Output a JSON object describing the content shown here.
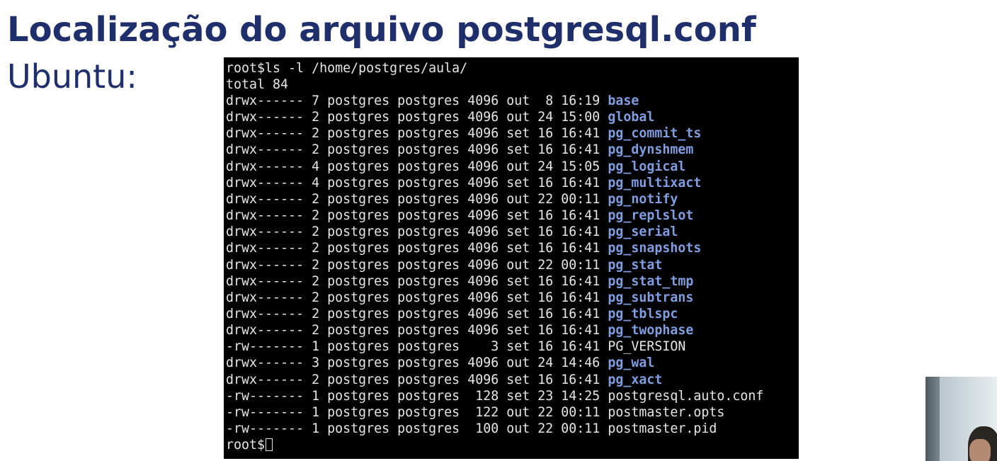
{
  "slide": {
    "title": "Localização do arquivo postgresql.conf",
    "subtitle": "Ubuntu:"
  },
  "terminal": {
    "top_fragment": "",
    "command_line": "root$ls -l /home/postgres/aula/",
    "total_line": "total 84",
    "entries": [
      {
        "info": "drwx------ 7 postgres postgres 4096 out  8 16:19 ",
        "name": "base",
        "type": "dir"
      },
      {
        "info": "drwx------ 2 postgres postgres 4096 out 24 15:00 ",
        "name": "global",
        "type": "dir"
      },
      {
        "info": "drwx------ 2 postgres postgres 4096 set 16 16:41 ",
        "name": "pg_commit_ts",
        "type": "dir"
      },
      {
        "info": "drwx------ 2 postgres postgres 4096 set 16 16:41 ",
        "name": "pg_dynshmem",
        "type": "dir"
      },
      {
        "info": "drwx------ 4 postgres postgres 4096 out 24 15:05 ",
        "name": "pg_logical",
        "type": "dir"
      },
      {
        "info": "drwx------ 4 postgres postgres 4096 set 16 16:41 ",
        "name": "pg_multixact",
        "type": "dir"
      },
      {
        "info": "drwx------ 2 postgres postgres 4096 out 22 00:11 ",
        "name": "pg_notify",
        "type": "dir"
      },
      {
        "info": "drwx------ 2 postgres postgres 4096 set 16 16:41 ",
        "name": "pg_replslot",
        "type": "dir"
      },
      {
        "info": "drwx------ 2 postgres postgres 4096 set 16 16:41 ",
        "name": "pg_serial",
        "type": "dir"
      },
      {
        "info": "drwx------ 2 postgres postgres 4096 set 16 16:41 ",
        "name": "pg_snapshots",
        "type": "dir"
      },
      {
        "info": "drwx------ 2 postgres postgres 4096 out 22 00:11 ",
        "name": "pg_stat",
        "type": "dir"
      },
      {
        "info": "drwx------ 2 postgres postgres 4096 set 16 16:41 ",
        "name": "pg_stat_tmp",
        "type": "dir"
      },
      {
        "info": "drwx------ 2 postgres postgres 4096 set 16 16:41 ",
        "name": "pg_subtrans",
        "type": "dir"
      },
      {
        "info": "drwx------ 2 postgres postgres 4096 set 16 16:41 ",
        "name": "pg_tblspc",
        "type": "dir"
      },
      {
        "info": "drwx------ 2 postgres postgres 4096 set 16 16:41 ",
        "name": "pg_twophase",
        "type": "dir"
      },
      {
        "info": "-rw------- 1 postgres postgres    3 set 16 16:41 ",
        "name": "PG_VERSION",
        "type": "file"
      },
      {
        "info": "drwx------ 3 postgres postgres 4096 out 24 14:46 ",
        "name": "pg_wal",
        "type": "dir"
      },
      {
        "info": "drwx------ 2 postgres postgres 4096 set 16 16:41 ",
        "name": "pg_xact",
        "type": "dir"
      },
      {
        "info": "-rw------- 1 postgres postgres  128 set 23 14:25 ",
        "name": "postgresql.auto.conf",
        "type": "file"
      },
      {
        "info": "-rw------- 1 postgres postgres  122 out 22 00:11 ",
        "name": "postmaster.opts",
        "type": "file"
      },
      {
        "info": "-rw------- 1 postgres postgres  100 out 22 00:11 ",
        "name": "postmaster.pid",
        "type": "file"
      }
    ],
    "prompt": "root$",
    "colors": {
      "background": "#000000",
      "text": "#e6e6e6",
      "directory": "#7f9de0"
    }
  },
  "theme": {
    "title_color": "#1f2f6b"
  }
}
